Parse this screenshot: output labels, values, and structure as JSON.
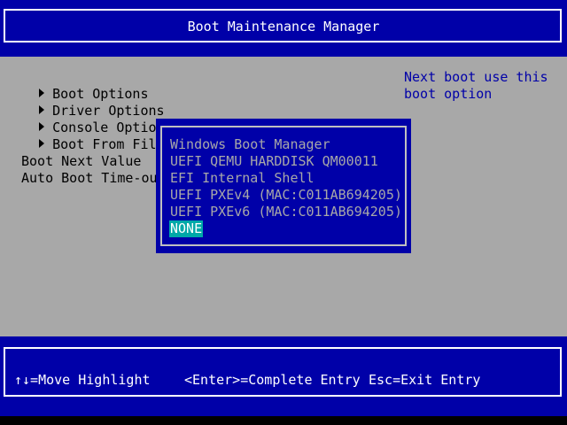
{
  "header": {
    "title": "Boot Maintenance Manager"
  },
  "menu": {
    "items": [
      {
        "label": "Boot Options",
        "arrow": true
      },
      {
        "label": "Driver Options",
        "arrow": true
      },
      {
        "label": "Console Options",
        "arrow": true
      },
      {
        "label": "Boot From File",
        "arrow": true
      }
    ],
    "fields": [
      {
        "label": "Boot Next Value"
      },
      {
        "label": "Auto Boot Time-out"
      }
    ]
  },
  "help": {
    "lines": [
      "Next boot use this",
      "boot option"
    ]
  },
  "popup": {
    "options": [
      "Windows Boot Manager",
      "UEFI QEMU HARDDISK QM00011",
      "EFI Internal Shell",
      "UEFI PXEv4 (MAC:C011AB694205)",
      "UEFI PXEv6 (MAC:C011AB694205)",
      "NONE"
    ],
    "selected_index": 5
  },
  "footer": {
    "hint_move": "↑↓=Move Highlight",
    "hint_enter": "<Enter>=Complete Entry",
    "hint_esc": "Esc=Exit Entry"
  },
  "colors": {
    "background": "#a8a8a8",
    "bar_blue": "#0000a8",
    "highlight_cyan": "#00a8a8",
    "help_text": "#0000a8"
  },
  "icons": {
    "submenu": "right-triangle-icon"
  }
}
